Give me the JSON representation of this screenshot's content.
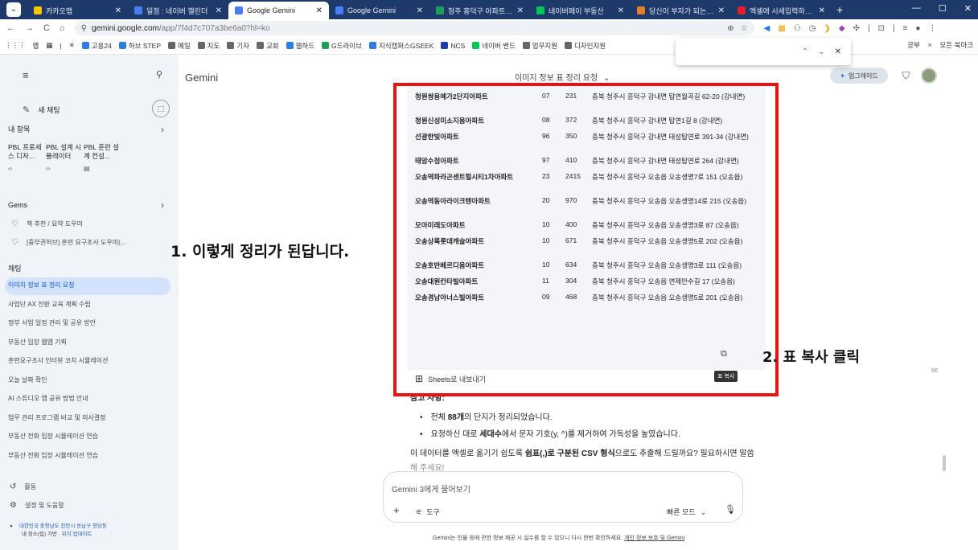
{
  "browser": {
    "tabs": [
      {
        "title": "카카오맵",
        "color": "#f7c600",
        "active": false
      },
      {
        "title": "일정 : 네이버 캘린더",
        "color": "#4a7cf7",
        "active": false
      },
      {
        "title": "Google Gemini",
        "color": "#4a7cf7",
        "active": true
      },
      {
        "title": "Google Gemini",
        "color": "#4a7cf7",
        "active": false
      },
      {
        "title": "청주 흥덕구 아파트 정보",
        "color": "#1e9e57",
        "active": false
      },
      {
        "title": "네이버페이 부동산",
        "color": "#03c75a",
        "active": false
      },
      {
        "title": "당신이 부자가 되는 곳!",
        "color": "#e57d2a",
        "active": false
      },
      {
        "title": "엑셀에 시세입력하기 - Yo",
        "color": "#e0202a",
        "active": false
      }
    ],
    "tab_add": "+",
    "window_controls": [
      "—",
      "☐",
      "✕"
    ],
    "nav": {
      "back": "←",
      "forward": "→",
      "reload": "C",
      "home": "⌂"
    },
    "url_host": "gemini.google.com",
    "url_path": "/app/7f4d7c707a3be6a0?hl=ko",
    "bookmarks": [
      {
        "label": "앱",
        "color": "#888888"
      },
      {
        "label": "고용24",
        "color": "#2e7de0"
      },
      {
        "label": "하브 STEP",
        "color": "#2e7de0"
      },
      {
        "label": "메일",
        "color": "#666666"
      },
      {
        "label": "지도",
        "color": "#666666"
      },
      {
        "label": "기자",
        "color": "#666666"
      },
      {
        "label": "교회",
        "color": "#666666"
      },
      {
        "label": "웹하드",
        "color": "#2e7de0"
      },
      {
        "label": "G드라이브",
        "color": "#1e9e57"
      },
      {
        "label": "지식캠퍼스GSEEK",
        "color": "#2e7de0"
      },
      {
        "label": "NCS",
        "color": "#1b3fa6"
      },
      {
        "label": "네이버 밴드",
        "color": "#03c75a"
      },
      {
        "label": "업무지원",
        "color": "#666666"
      },
      {
        "label": "디자인지원",
        "color": "#666666"
      }
    ],
    "bookmarks_right": [
      "공부",
      "»",
      "모든 북마크"
    ],
    "find_popup": {
      "up": "⌃",
      "down": "⌄",
      "close": "✕"
    }
  },
  "sidebar": {
    "new_chat": "새 채팅",
    "my_items": "내 항목",
    "chips": [
      {
        "label": "PBL 프로세스 디자...",
        "icon": "‹›"
      },
      {
        "label": "PBL 설계 시뮬레이터",
        "icon": "‹›"
      },
      {
        "label": "PBL 훈련 설계 컨설...",
        "icon": "▤"
      }
    ],
    "gems_header": "Gems",
    "gems": [
      "책 추천 / 요약 도우미",
      "[중부권허브] 훈련 요구조사 도우미(..."
    ],
    "chats_header": "채팅",
    "chats": [
      "이미지 정보 표 정리 요청",
      "사업단 AX 전환 교육 계획 수립",
      "정부 사업 일정 관리 및 공유 방안",
      "부동산 임장 웹앱 기획",
      "훈련요구조사 인터뷰 코치 시뮬레이션",
      "오늘 날짜 확인",
      "AI 스튜디오 앱 공유 방법 안내",
      "업무 관리 프로그램 비교 및 의사결정",
      "부동산 전화 임장 시뮬레이션 연습",
      "부동산 전화 임장 시뮬레이션 연습"
    ],
    "activity": "활동",
    "settings": "설정 및 도움말",
    "location_line1": "대한민국 충청남도 천안시 동남구 청당동",
    "location_line2_prefix": "내 장소(집) 기반 · ",
    "location_link": "위치 업데이트"
  },
  "main": {
    "app_name": "Gemini",
    "chat_title": "이미지 정보 표 정리 요청",
    "upgrade": "업그레이드",
    "table_rows": [
      {
        "name": "청원쌍용예가2단지아파트",
        "a": "07",
        "b": "231",
        "addr": "충북 청주시 흥덕구 강내면 탑연월곡길 62-20 (강내면)"
      },
      {
        "name": "청원신성미소지움아파트",
        "a": "08",
        "b": "372",
        "addr": "충북 청주시 흥덕구 강내면 탑연1길 8 (강내면)"
      },
      {
        "name": "선광한빛아파트",
        "a": "96",
        "b": "350",
        "addr": "충북 청주시 흥덕구 강내면 태성탑연로 391-34 (강내면)"
      },
      {
        "name": "태암수정아파트",
        "a": "97",
        "b": "410",
        "addr": "충북 청주시 흥덕구 강내면 태성탑연로 264 (강내면)"
      },
      {
        "name": "오송역파라곤센트럴시티1차아파트",
        "a": "23",
        "b": "2415",
        "addr": "충북 청주시 흥덕구 오송읍 오송생명7로 151 (오송읍)"
      },
      {
        "name": "오송역동아라이크텐아파트",
        "a": "20",
        "b": "970",
        "addr": "충북 청주시 흥덕구 오송읍 오송생명14로 215 (오송읍)"
      },
      {
        "name": "모아미래도아파트",
        "a": "10",
        "b": "400",
        "addr": "충북 청주시 흥덕구 오송읍 오송생명3로 87 (오송읍)"
      },
      {
        "name": "오송상록롯데캐슬아파트",
        "a": "10",
        "b": "671",
        "addr": "충북 청주시 흥덕구 오송읍 오송생명5로 202 (오송읍)"
      },
      {
        "name": "오송호반베르디움아파트",
        "a": "10",
        "b": "634",
        "addr": "충북 청주시 흥덕구 오송읍 오송생명3로 111 (오송읍)"
      },
      {
        "name": "오송대원칸타빌아파트",
        "a": "11",
        "b": "304",
        "addr": "충북 청주시 흥덕구 오송읍 연제만수길 17 (오송읍)"
      },
      {
        "name": "오송경남아너스빌아파트",
        "a": "09",
        "b": "468",
        "addr": "충북 청주시 흥덕구 오송읍 오송생명5로 201 (오송읍)"
      }
    ],
    "sheets_export": "Sheets로 내보내기",
    "copy_tooltip": "표 복사",
    "note_partial": "참고 사항:",
    "bullet1_pre": "전체 ",
    "bullet1_bold": "88개",
    "bullet1_post": "의 단지가 정리되었습니다.",
    "bullet2_pre": "요청하신 대로 ",
    "bullet2_bold": "세대수",
    "bullet2_post": "에서 문자 기호(y, ^)를 제거하여 가독성을 높였습니다.",
    "para_line1_pre": "이 데이터를 엑셀로 옮기기 쉽도록 ",
    "para_line1_bold": "쉼표(,)로 구분된 CSV 형식",
    "para_line1_post": "으로도 추출해 드릴까요? 필요하시면 말씀",
    "para_line2": "해 주세요!",
    "composer_placeholder": "Gemini 3에게 물어보기",
    "tools": "도구",
    "mode": "빠른 모드",
    "footer_text": "Gemini는 인물 등에 관한 정보 제공 시 실수를 할 수 있으니 다시 한번 확인하세요. ",
    "footer_link": "개인 정보 보호 및 Gemini"
  },
  "annotations": {
    "step1": "1. 이렇게 정리가 된답니다.",
    "step2": "2. 표 복사 클릭",
    "frame_color": "#ee1111"
  }
}
